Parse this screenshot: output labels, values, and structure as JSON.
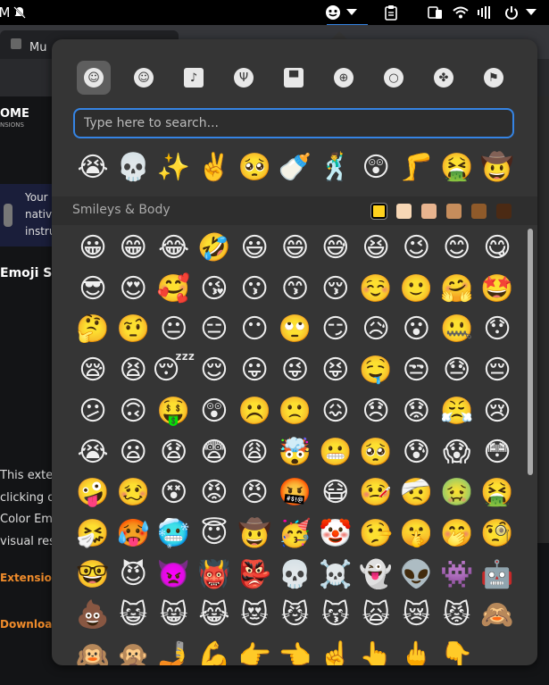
{
  "topbar": {
    "left_label": "M",
    "bell_icon": "bell-mute-icon",
    "emoji_icon": "emoji-menu-icon",
    "dropdown": "▾"
  },
  "browser": {
    "tab_title": "Mu",
    "logo_text": "OME",
    "logo_sub": "NSIONS",
    "notice_lines": [
      "Your",
      "nativ",
      "instru"
    ],
    "heading": "Emoji Se",
    "paragraph": [
      "This exter",
      "clicking o",
      "Color Em",
      "visual res"
    ],
    "link_label": "Extension I",
    "download_label": "Download"
  },
  "emoji_picker": {
    "categories": [
      {
        "name": "smileys",
        "icon": "☺",
        "active": true
      },
      {
        "name": "people",
        "icon": "☺",
        "active": false
      },
      {
        "name": "animals-nature",
        "icon": "♪",
        "active": false
      },
      {
        "name": "food",
        "icon": "Ψ",
        "active": false
      },
      {
        "name": "travel",
        "icon": "▀",
        "active": false
      },
      {
        "name": "activities",
        "icon": "⊕",
        "active": false
      },
      {
        "name": "objects",
        "icon": "○",
        "active": false
      },
      {
        "name": "symbols",
        "icon": "✤",
        "active": false
      },
      {
        "name": "flags",
        "icon": "⚑",
        "active": false
      }
    ],
    "search_placeholder": "Type here to search...",
    "recent": [
      "😭",
      "💀",
      "✨",
      "✌️",
      "🥺",
      "🍼",
      "🕺",
      "😲",
      "🦵",
      "🤮",
      "🤠"
    ],
    "section_title": "Smileys & Body",
    "skin_tones": [
      "#ffd21e",
      "#f7d7b5",
      "#e8b48f",
      "#c68d5c",
      "#8f5a2a",
      "#4b2a14"
    ],
    "selected_tone": 0,
    "emojis": [
      "😀",
      "😁",
      "😂",
      "🤣",
      "😃",
      "😄",
      "😅",
      "😆",
      "😉",
      "😊",
      "😋",
      "😎",
      "😍",
      "🥰",
      "😘",
      "😗",
      "😙",
      "😚",
      "☺️",
      "🙂",
      "🤗",
      "🤩",
      "🤔",
      "🤨",
      "😐",
      "😑",
      "😶",
      "🙄",
      "😏",
      "😥",
      "😮",
      "🤐",
      "😯",
      "😪",
      "😫",
      "😴",
      "😌",
      "😛",
      "😜",
      "😝",
      "🤤",
      "😒",
      "😓",
      "😔",
      "😕",
      "🙃",
      "🤑",
      "😲",
      "☹️",
      "🙁",
      "😖",
      "😞",
      "😟",
      "😤",
      "😢",
      "😭",
      "😦",
      "😧",
      "😨",
      "😩",
      "🤯",
      "😬",
      "🥺",
      "😰",
      "😱",
      "😳",
      "🤪",
      "🥴",
      "😵",
      "😡",
      "😠",
      "🤬",
      "😷",
      "🤒",
      "🤕",
      "🤢",
      "🤮",
      "🤧",
      "🥵",
      "🥶",
      "😇",
      "🤠",
      "🥳",
      "🤡",
      "🤥",
      "🤫",
      "🤭",
      "🧐",
      "🤓",
      "😈",
      "👿",
      "👹",
      "👺",
      "💀",
      "☠️",
      "👻",
      "👽",
      "👾",
      "🤖",
      "💩",
      "😺",
      "😸",
      "😹",
      "😻",
      "😼",
      "😽",
      "🙀",
      "😿",
      "😾",
      "🙈",
      "🙉",
      "🙊",
      "🤳",
      "💪",
      "👉",
      "👈",
      "☝️",
      "👆",
      "🖕",
      "👇"
    ]
  }
}
